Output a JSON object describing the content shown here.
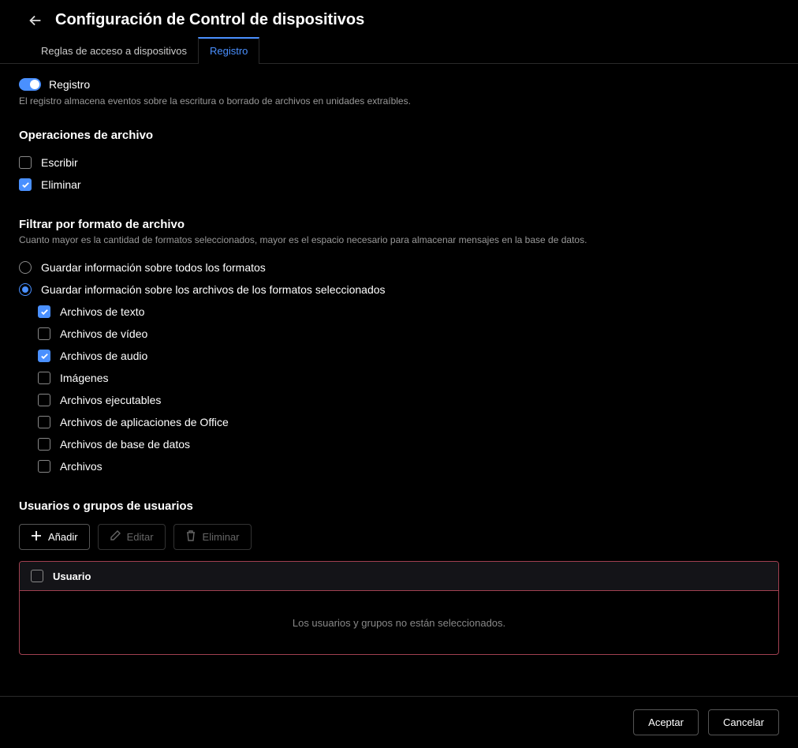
{
  "header": {
    "title": "Configuración de Control de dispositivos"
  },
  "tabs": {
    "access_rules": "Reglas de acceso a dispositivos",
    "log": "Registro"
  },
  "log_toggle": {
    "label": "Registro",
    "desc": "El registro almacena eventos sobre la escritura o borrado de archivos en unidades extraíbles."
  },
  "file_ops": {
    "title": "Operaciones de archivo",
    "write": "Escribir",
    "delete": "Eliminar"
  },
  "format_filter": {
    "title": "Filtrar por formato de archivo",
    "desc": "Cuanto mayor es la cantidad de formatos seleccionados, mayor es el espacio necesario para almacenar mensajes en la base de datos.",
    "opt_all": "Guardar información sobre todos los formatos",
    "opt_selected": "Guardar información sobre los archivos de los formatos seleccionados",
    "formats": {
      "text": "Archivos de texto",
      "video": "Archivos de vídeo",
      "audio": "Archivos de audio",
      "images": "Imágenes",
      "exe": "Archivos ejecutables",
      "office": "Archivos de aplicaciones de Office",
      "db": "Archivos de base de datos",
      "archive": "Archivos"
    }
  },
  "users": {
    "title": "Usuarios o grupos de usuarios",
    "add": "Añadir",
    "edit": "Editar",
    "delete": "Eliminar",
    "col_user": "Usuario",
    "empty": "Los usuarios y grupos no están seleccionados."
  },
  "footer": {
    "accept": "Aceptar",
    "cancel": "Cancelar"
  }
}
